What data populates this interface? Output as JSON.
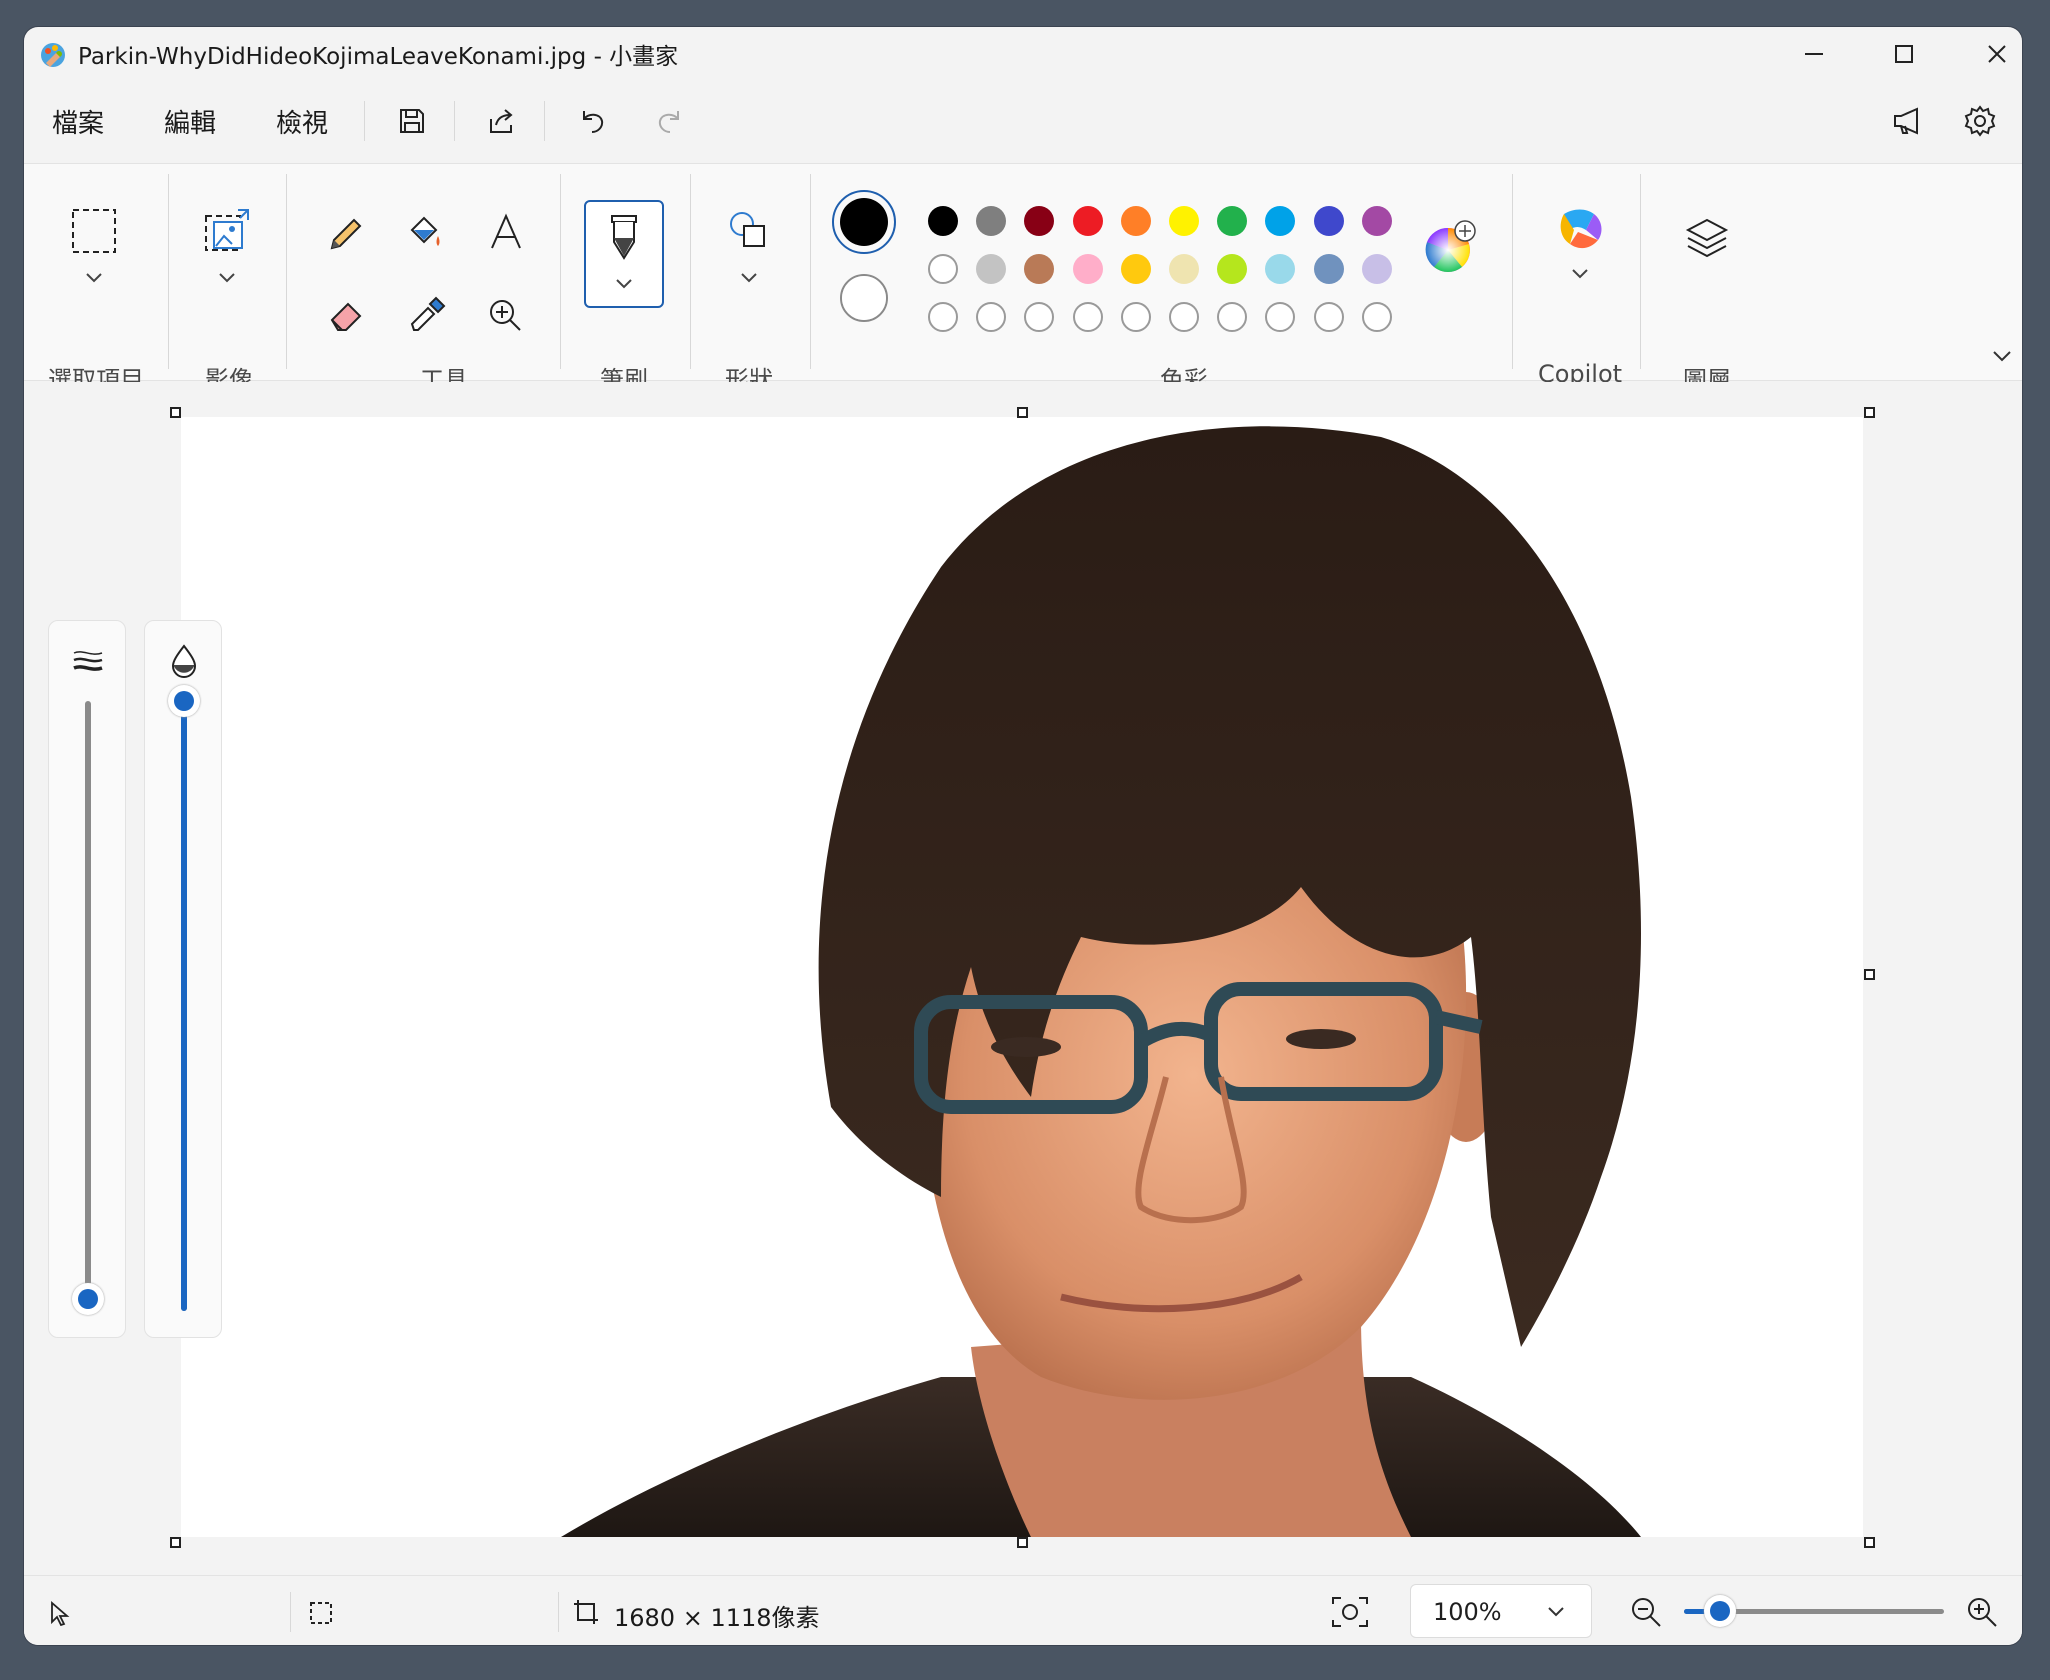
{
  "window": {
    "title": "Parkin-WhyDidHideoKojimaLeaveKonami.jpg - 小畫家"
  },
  "menu": {
    "file": "檔案",
    "edit": "編輯",
    "view": "檢視"
  },
  "ribbon": {
    "groups": {
      "selection": "選取項目",
      "image": "影像",
      "tools": "工具",
      "brushes": "筆刷",
      "shapes": "形狀",
      "colors": "色彩",
      "copilot": "Copilot",
      "layers": "圖層"
    },
    "primary_color": "#000000",
    "secondary_color": "#ffffff",
    "palette_row1": [
      "#000000",
      "#7f7f7f",
      "#880015",
      "#ed1c24",
      "#ff7f27",
      "#fff200",
      "#22b14c",
      "#00a2e8",
      "#3f48cc",
      "#a349a4"
    ],
    "palette_row2": [
      "#ffffff",
      "#c3c3c3",
      "#b97a57",
      "#ffaec9",
      "#ffc90e",
      "#efe4b0",
      "#b5e61d",
      "#99d9ea",
      "#7092be",
      "#c8bfe7"
    ]
  },
  "sliders": {
    "size_level": 0.02,
    "opacity_level": 1.0
  },
  "status": {
    "dimensions": "1680 × 1118像素",
    "zoom": "100%",
    "zoom_level": 0.14
  }
}
